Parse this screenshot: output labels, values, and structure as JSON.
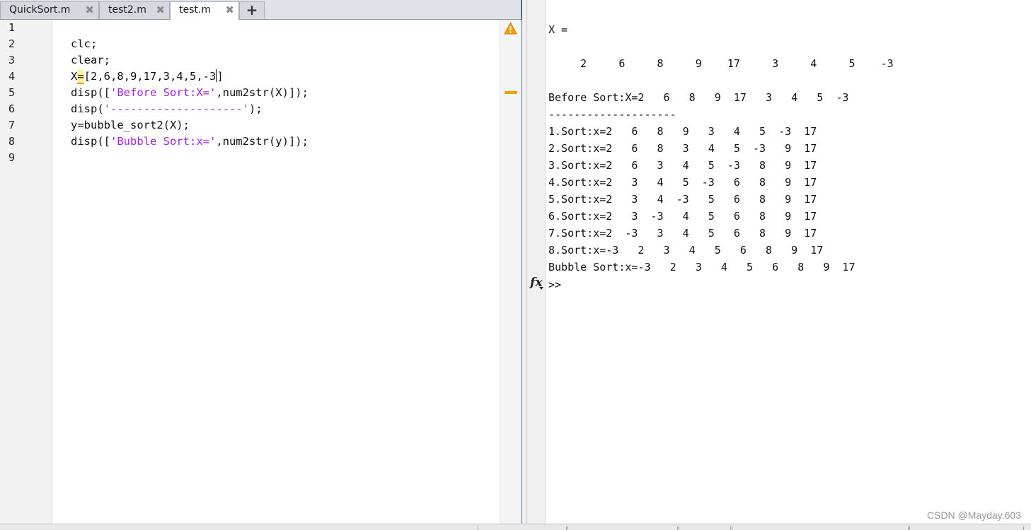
{
  "editor": {
    "tabs": [
      {
        "label": "QuickSort.m",
        "close": "✖"
      },
      {
        "label": "test2.m",
        "close": "✖"
      },
      {
        "label": "test.m",
        "close": "✖"
      }
    ],
    "add_tab": "+",
    "line_numbers": [
      "1",
      "2",
      "3",
      "4",
      "5",
      "6",
      "7",
      "8",
      "9"
    ],
    "code": {
      "l2": "clc;",
      "l3": "clear;",
      "l4_a": "X",
      "l4_eq": "=",
      "l4_b": "[2,6,8,9,17,3,4,5,-3",
      "l4_c": "]",
      "l5_a": "disp([",
      "l5_str": "'Before Sort:X='",
      "l5_b": ",num2str(X)]);",
      "l6_a": "disp(",
      "l6_str": "'--------------------'",
      "l6_b": ");",
      "l7": "y=bubble_sort2(X);",
      "l8_a": "disp([",
      "l8_str": "'Bubble Sort:x='",
      "l8_b": ",num2str(y)]);"
    },
    "warning_icon": "warning-triangle-icon"
  },
  "command_window": {
    "lines": [
      "X =",
      "",
      "     2     6     8     9    17     3     4     5    -3",
      "",
      "Before Sort:X=2   6   8   9  17   3   4   5  -3",
      "--------------------",
      "1.Sort:x=2   6   8   9   3   4   5  -3  17",
      "2.Sort:x=2   6   8   3   4   5  -3   9  17",
      "3.Sort:x=2   6   3   4   5  -3   8   9  17",
      "4.Sort:x=2   3   4   5  -3   6   8   9  17",
      "5.Sort:x=2   3   4  -3   5   6   8   9  17",
      "6.Sort:x=2   3  -3   4   5   6   8   9  17",
      "7.Sort:x=2  -3   3   4   5   6   8   9  17",
      "8.Sort:x=-3   2   3   4   5   6   8   9  17",
      "Bubble Sort:x=-3   2   3   4   5   6   8   9  17"
    ],
    "fx_label": "fx",
    "prompt": ">>"
  },
  "watermark": "CSDN @Mayday.603",
  "colors": {
    "string": "#a020f0",
    "warning": "#f0a000",
    "panel_border": "#4a6e8c"
  }
}
